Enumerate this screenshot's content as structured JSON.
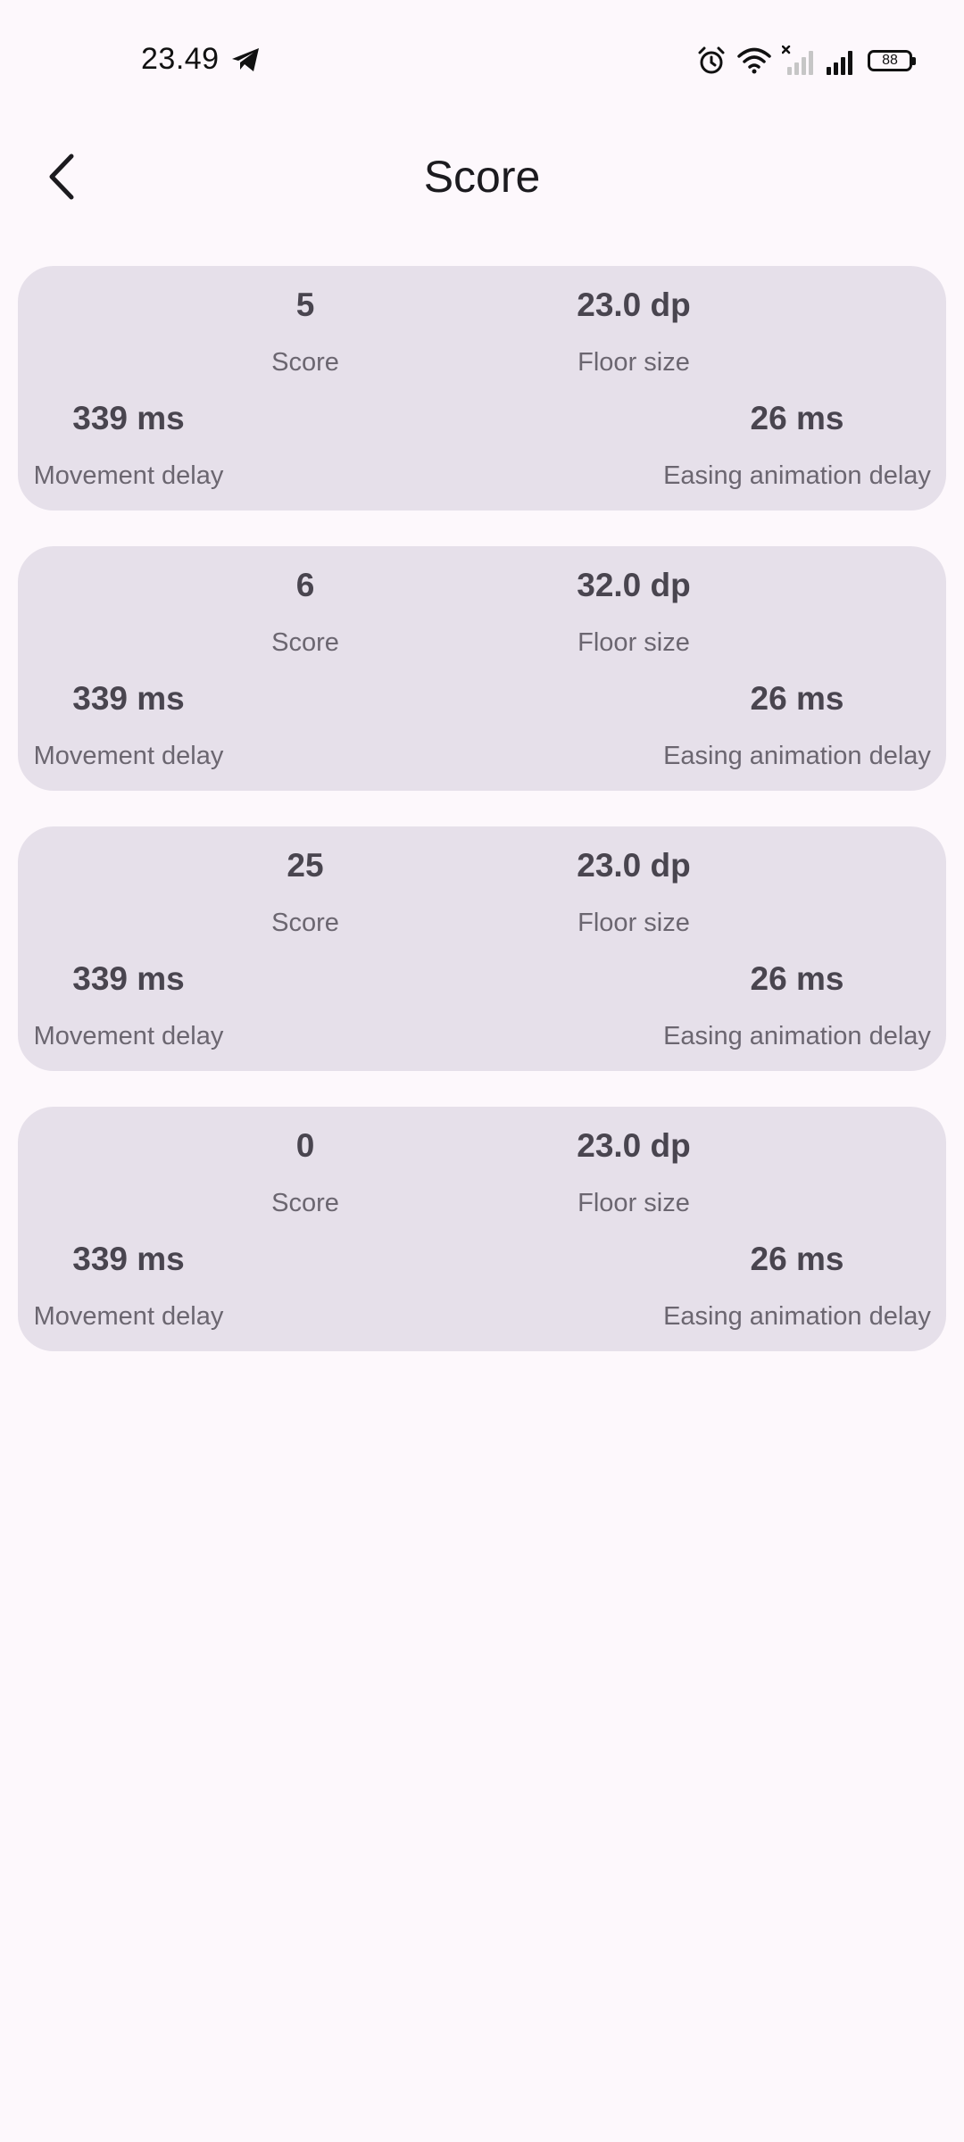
{
  "status_bar": {
    "time": "23.49",
    "battery_level": "88",
    "icons": [
      "telegram-icon",
      "alarm-icon",
      "wifi-icon",
      "no-signal-icon",
      "signal-icon",
      "battery-icon"
    ]
  },
  "app_bar": {
    "title": "Score",
    "back_icon": "chevron-left-icon"
  },
  "colors": {
    "background": "#fdf8fc",
    "card": "#e6e0ea",
    "value_text": "#49454f",
    "label_text": "#6b6670"
  },
  "entries": [
    {
      "score": "5",
      "score_label": "Score",
      "floor_size": "23.0 dp",
      "floor_size_label": "Floor size",
      "movement_delay": "339 ms",
      "movement_delay_label": "Movement delay",
      "easing_delay": "26 ms",
      "easing_delay_label": "Easing animation delay"
    },
    {
      "score": "6",
      "score_label": "Score",
      "floor_size": "32.0 dp",
      "floor_size_label": "Floor size",
      "movement_delay": "339 ms",
      "movement_delay_label": "Movement delay",
      "easing_delay": "26 ms",
      "easing_delay_label": "Easing animation delay"
    },
    {
      "score": "25",
      "score_label": "Score",
      "floor_size": "23.0 dp",
      "floor_size_label": "Floor size",
      "movement_delay": "339 ms",
      "movement_delay_label": "Movement delay",
      "easing_delay": "26 ms",
      "easing_delay_label": "Easing animation delay"
    },
    {
      "score": "0",
      "score_label": "Score",
      "floor_size": "23.0 dp",
      "floor_size_label": "Floor size",
      "movement_delay": "339 ms",
      "movement_delay_label": "Movement delay",
      "easing_delay": "26 ms",
      "easing_delay_label": "Easing animation delay"
    }
  ]
}
